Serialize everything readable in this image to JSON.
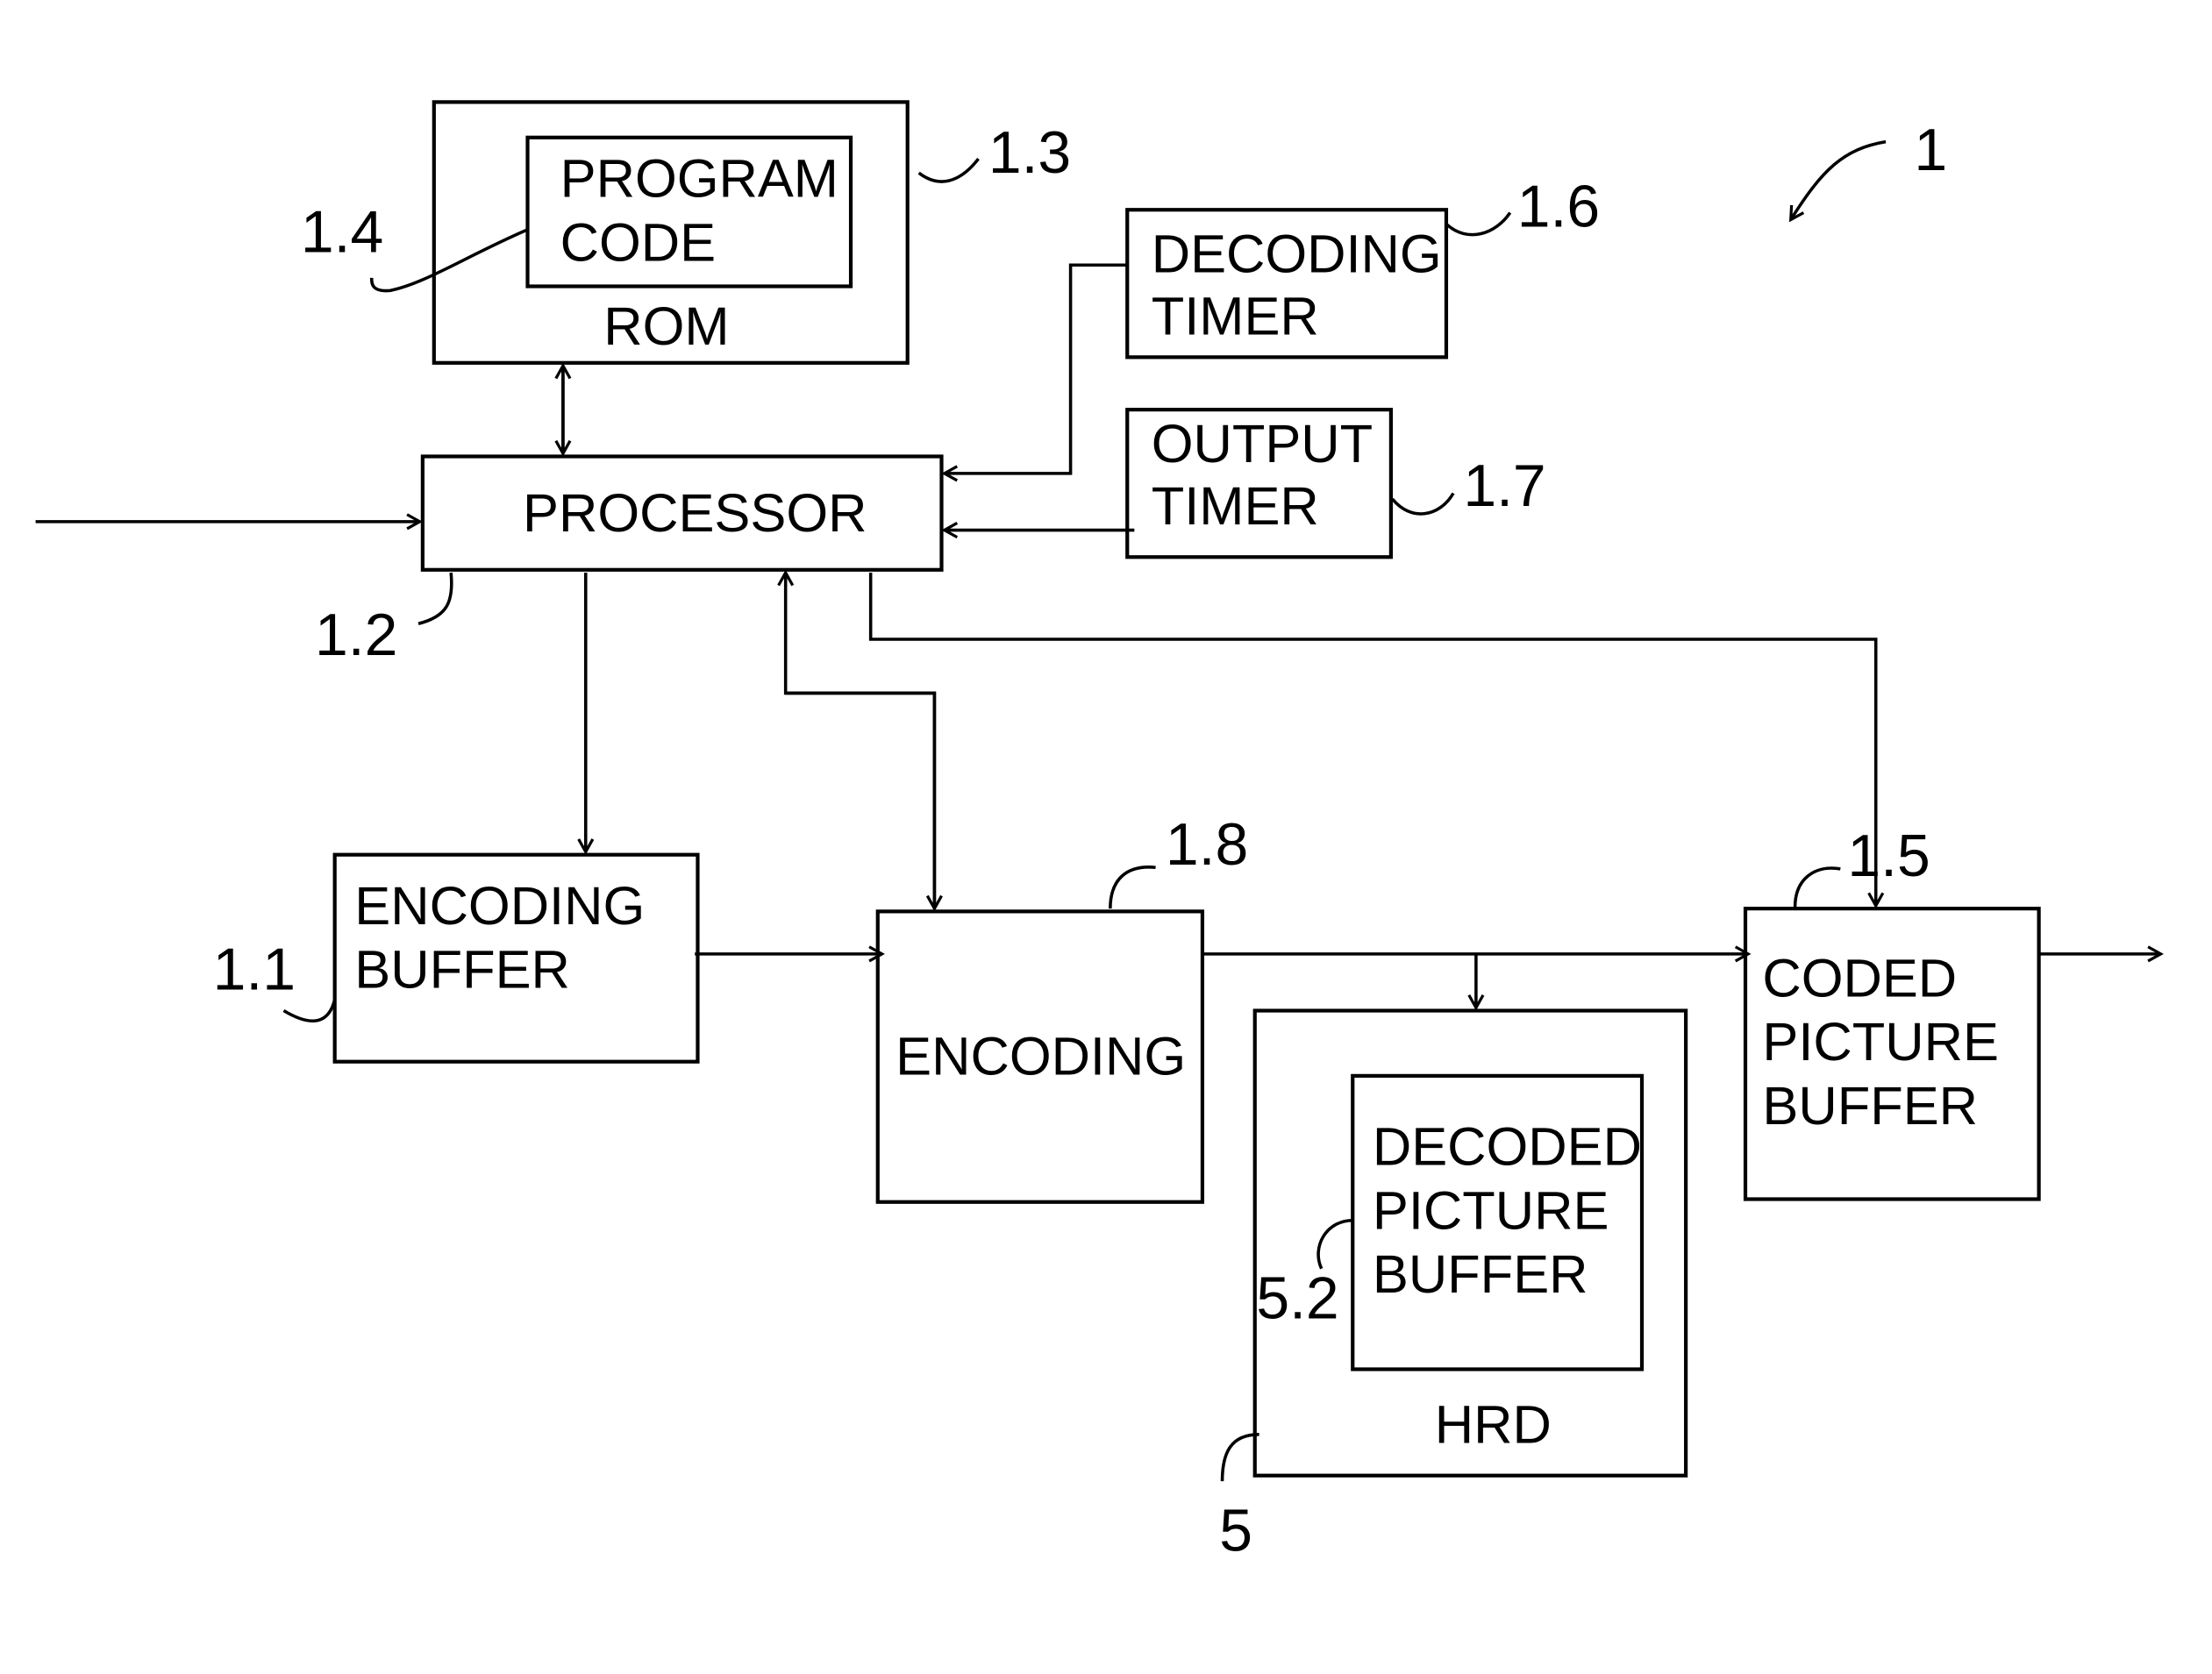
{
  "figure": {
    "reference": "1",
    "blocks": {
      "rom": {
        "ref": "1.3",
        "label": "ROM"
      },
      "program_code": {
        "ref": "1.4",
        "lines": [
          "PROGRAM",
          "CODE"
        ]
      },
      "decoding_timer": {
        "ref": "1.6",
        "lines": [
          "DECODING",
          "TIMER"
        ]
      },
      "output_timer": {
        "ref": "1.7",
        "lines": [
          "OUTPUT",
          "TIMER"
        ]
      },
      "processor": {
        "ref": "1.2",
        "label": "PROCESSOR"
      },
      "encoding_buffer": {
        "ref": "1.1",
        "lines": [
          "ENCODING",
          "BUFFER"
        ]
      },
      "encoding": {
        "ref": "1.8",
        "label": "ENCODING"
      },
      "hrd": {
        "ref": "5",
        "label": "HRD"
      },
      "decoded_picture_buffer": {
        "ref": "5.2",
        "lines": [
          "DECODED",
          "PICTURE",
          "BUFFER"
        ]
      },
      "coded_picture_buffer": {
        "ref": "1.5",
        "lines": [
          "CODED",
          "PICTURE",
          "BUFFER"
        ]
      }
    }
  }
}
